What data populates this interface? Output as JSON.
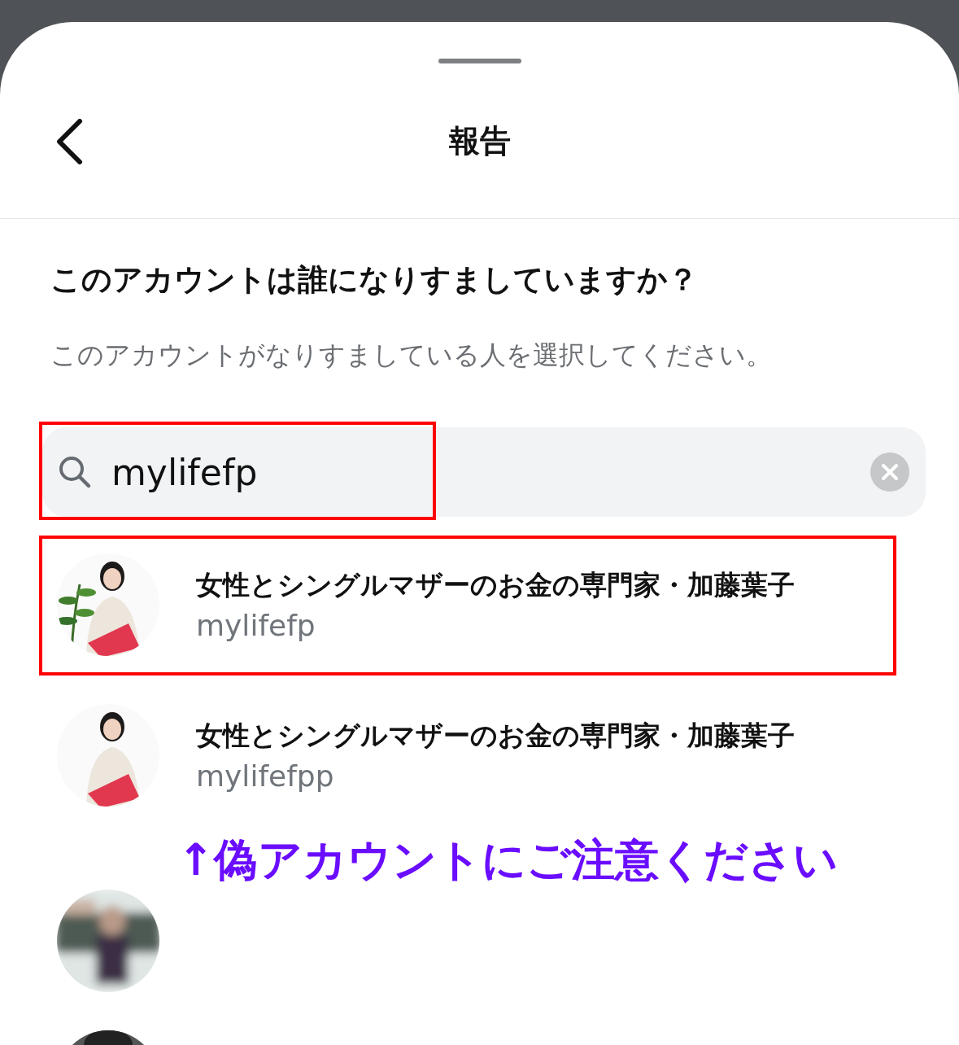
{
  "header": {
    "title": "報告"
  },
  "question": {
    "heading": "このアカウントは誰になりすましていますか？",
    "description": "このアカウントがなりすましている人を選択してください。"
  },
  "search": {
    "value": "mylifefp",
    "highlighted": true
  },
  "results": [
    {
      "kind": "account",
      "name": "女性とシングルマザーのお金の専門家・加藤葉子",
      "handle": "mylifefp",
      "highlighted": true
    },
    {
      "kind": "account",
      "name": "女性とシングルマザーのお金の専門家・加藤葉子",
      "handle": "mylifefpp",
      "highlighted": false
    },
    {
      "kind": "blurred",
      "highlighted": false
    },
    {
      "kind": "partial",
      "highlighted": false
    }
  ],
  "annotation": {
    "text": "↑偽アカウントにご注意ください"
  }
}
